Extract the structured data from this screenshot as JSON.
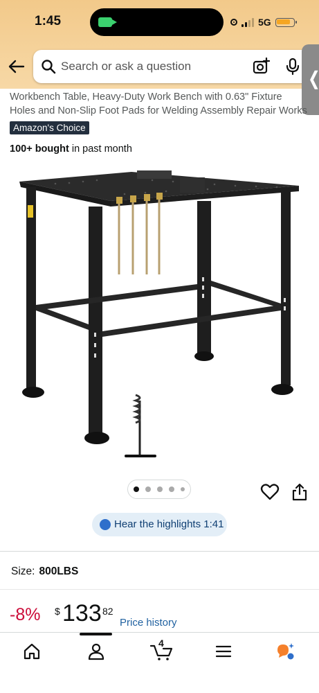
{
  "status_bar": {
    "time": "1:45",
    "network": "5G",
    "battery_level": 0.75,
    "signal_bars": 2,
    "accent": "#3bd16f"
  },
  "search": {
    "placeholder": "Search or ask a question",
    "icons": [
      "back-arrow-icon",
      "search-icon",
      "camera-lens-icon",
      "microphone-icon"
    ]
  },
  "side_handle": {
    "glyph": "❬"
  },
  "product": {
    "title_clipped": "Workbench Table, Heavy-Duty Work Bench with 0.63\" Fixture",
    "title_line1": "Workbench Table, Heavy-Duty Work Bench with 0.63\" Fixture",
    "title_line2": "Holes and Non-Slip Foot Pads for Welding Assembly Repair Works",
    "badge": "Amazon's Choice",
    "bought_bold": "100+ bought",
    "bought_rest": " in past month",
    "image_icon": "welding-table-image",
    "carousel": {
      "count": 5,
      "active_index": 0
    }
  },
  "actions": {
    "icons": [
      "heart-icon",
      "share-icon"
    ]
  },
  "highlights": {
    "label": "Hear the highlights 1:41"
  },
  "size": {
    "label": "Size:",
    "value": "800LBS"
  },
  "price": {
    "discount": "-8%",
    "symbol": "$",
    "whole": "133",
    "fraction": "82",
    "history_link": "Price history",
    "discount_color": "#cc0c39",
    "link_color": "#2162a1"
  },
  "tab_bar": {
    "cart_count": "4",
    "active_tab": "account",
    "tabs": [
      "home-icon",
      "account-icon",
      "cart-icon",
      "menu-icon",
      "rufus-icon"
    ]
  }
}
